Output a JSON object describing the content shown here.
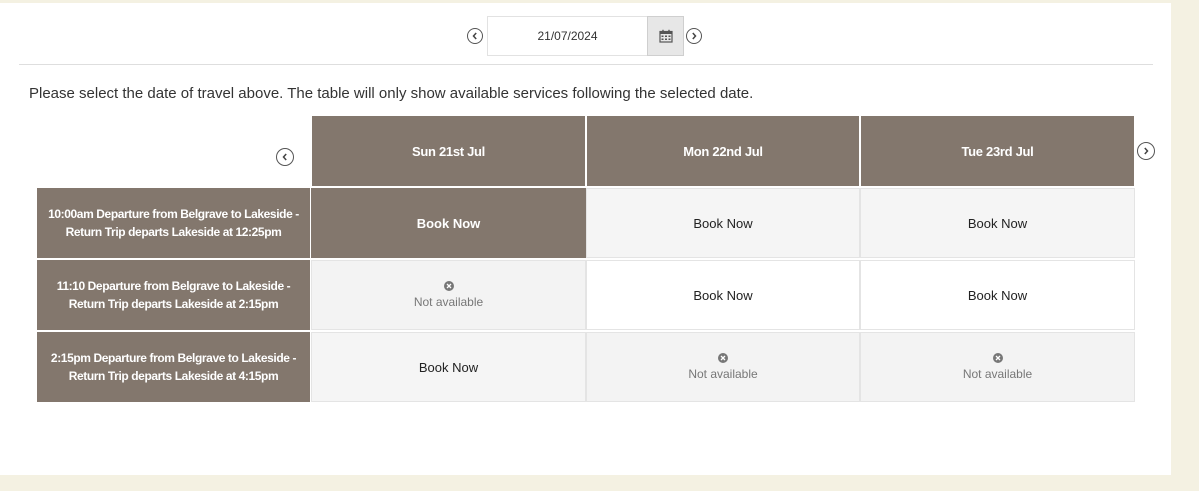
{
  "date_picker": {
    "value": "21/07/2024",
    "prev_icon": "chevron-left-circle-icon",
    "next_icon": "chevron-right-circle-icon",
    "calendar_icon": "calendar-icon"
  },
  "instructions": "Please select the date of travel above. The table will only show available services following the selected date.",
  "timetable": {
    "columns": [
      {
        "label": "Sun 21st Jul"
      },
      {
        "label": "Mon 22nd Jul"
      },
      {
        "label": "Tue 23rd Jul"
      }
    ],
    "rows": [
      {
        "label": "10:00am Departure from Belgrave to Lakeside - Return Trip departs Lakeside at 12:25pm",
        "cells": [
          "Book Now",
          "Book Now",
          "Book Now"
        ]
      },
      {
        "label": "11:10 Departure from Belgrave to Lakeside - Return Trip departs Lakeside at 2:15pm",
        "cells": [
          "Not available",
          "Book Now",
          "Book Now"
        ]
      },
      {
        "label": "2:15pm Departure from Belgrave to Lakeside - Return Trip departs Lakeside at 4:15pm",
        "cells": [
          "Book Now",
          "Not available",
          "Not available"
        ]
      }
    ]
  },
  "colors": {
    "header_bg": "#83776d",
    "page_bg": "#f4f1e2",
    "unavailable_bg": "#f3f3f3"
  }
}
